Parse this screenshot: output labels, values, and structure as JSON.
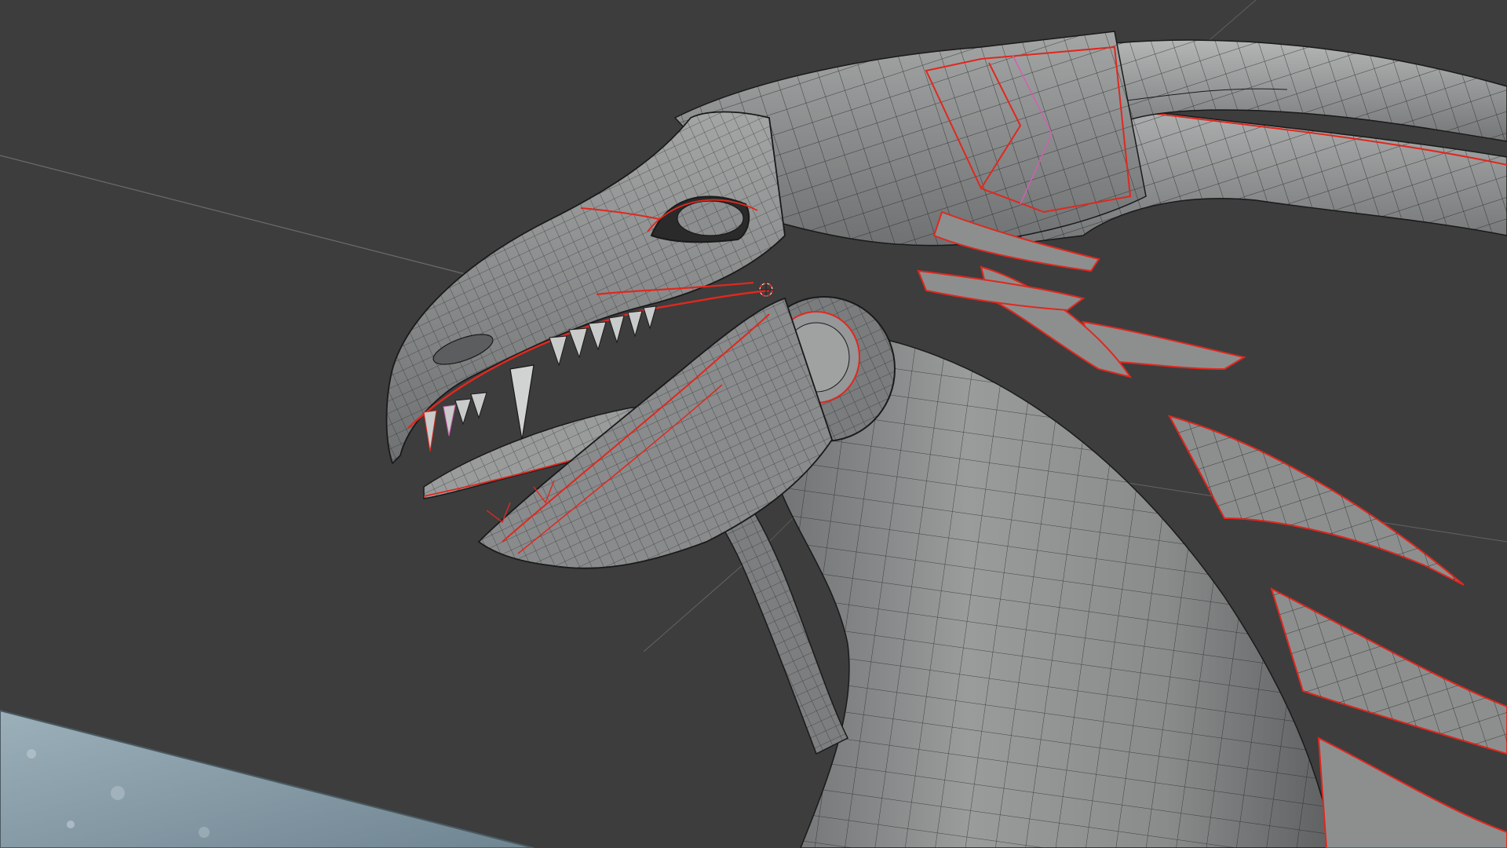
{
  "viewport": {
    "mode": "edit-mode-wireframe-overlay",
    "colors": {
      "background": "#3d3d3d",
      "mesh_fill": "#8d8f8f",
      "mesh_fill_dark": "#6a6c6d",
      "mesh_fill_light": "#b0b2b2",
      "wire": "#1a1a1a",
      "seam": "#e0281e",
      "seam_pink": "#d060b0",
      "grid_line": "#8a8a8a",
      "reference_plane": "#8aa0ab"
    },
    "objects": [
      {
        "name": "dragon-head-mesh",
        "selected": true
      },
      {
        "name": "reference-image-plane",
        "selected": false
      }
    ],
    "cursor_3d": {
      "visible": true
    }
  }
}
